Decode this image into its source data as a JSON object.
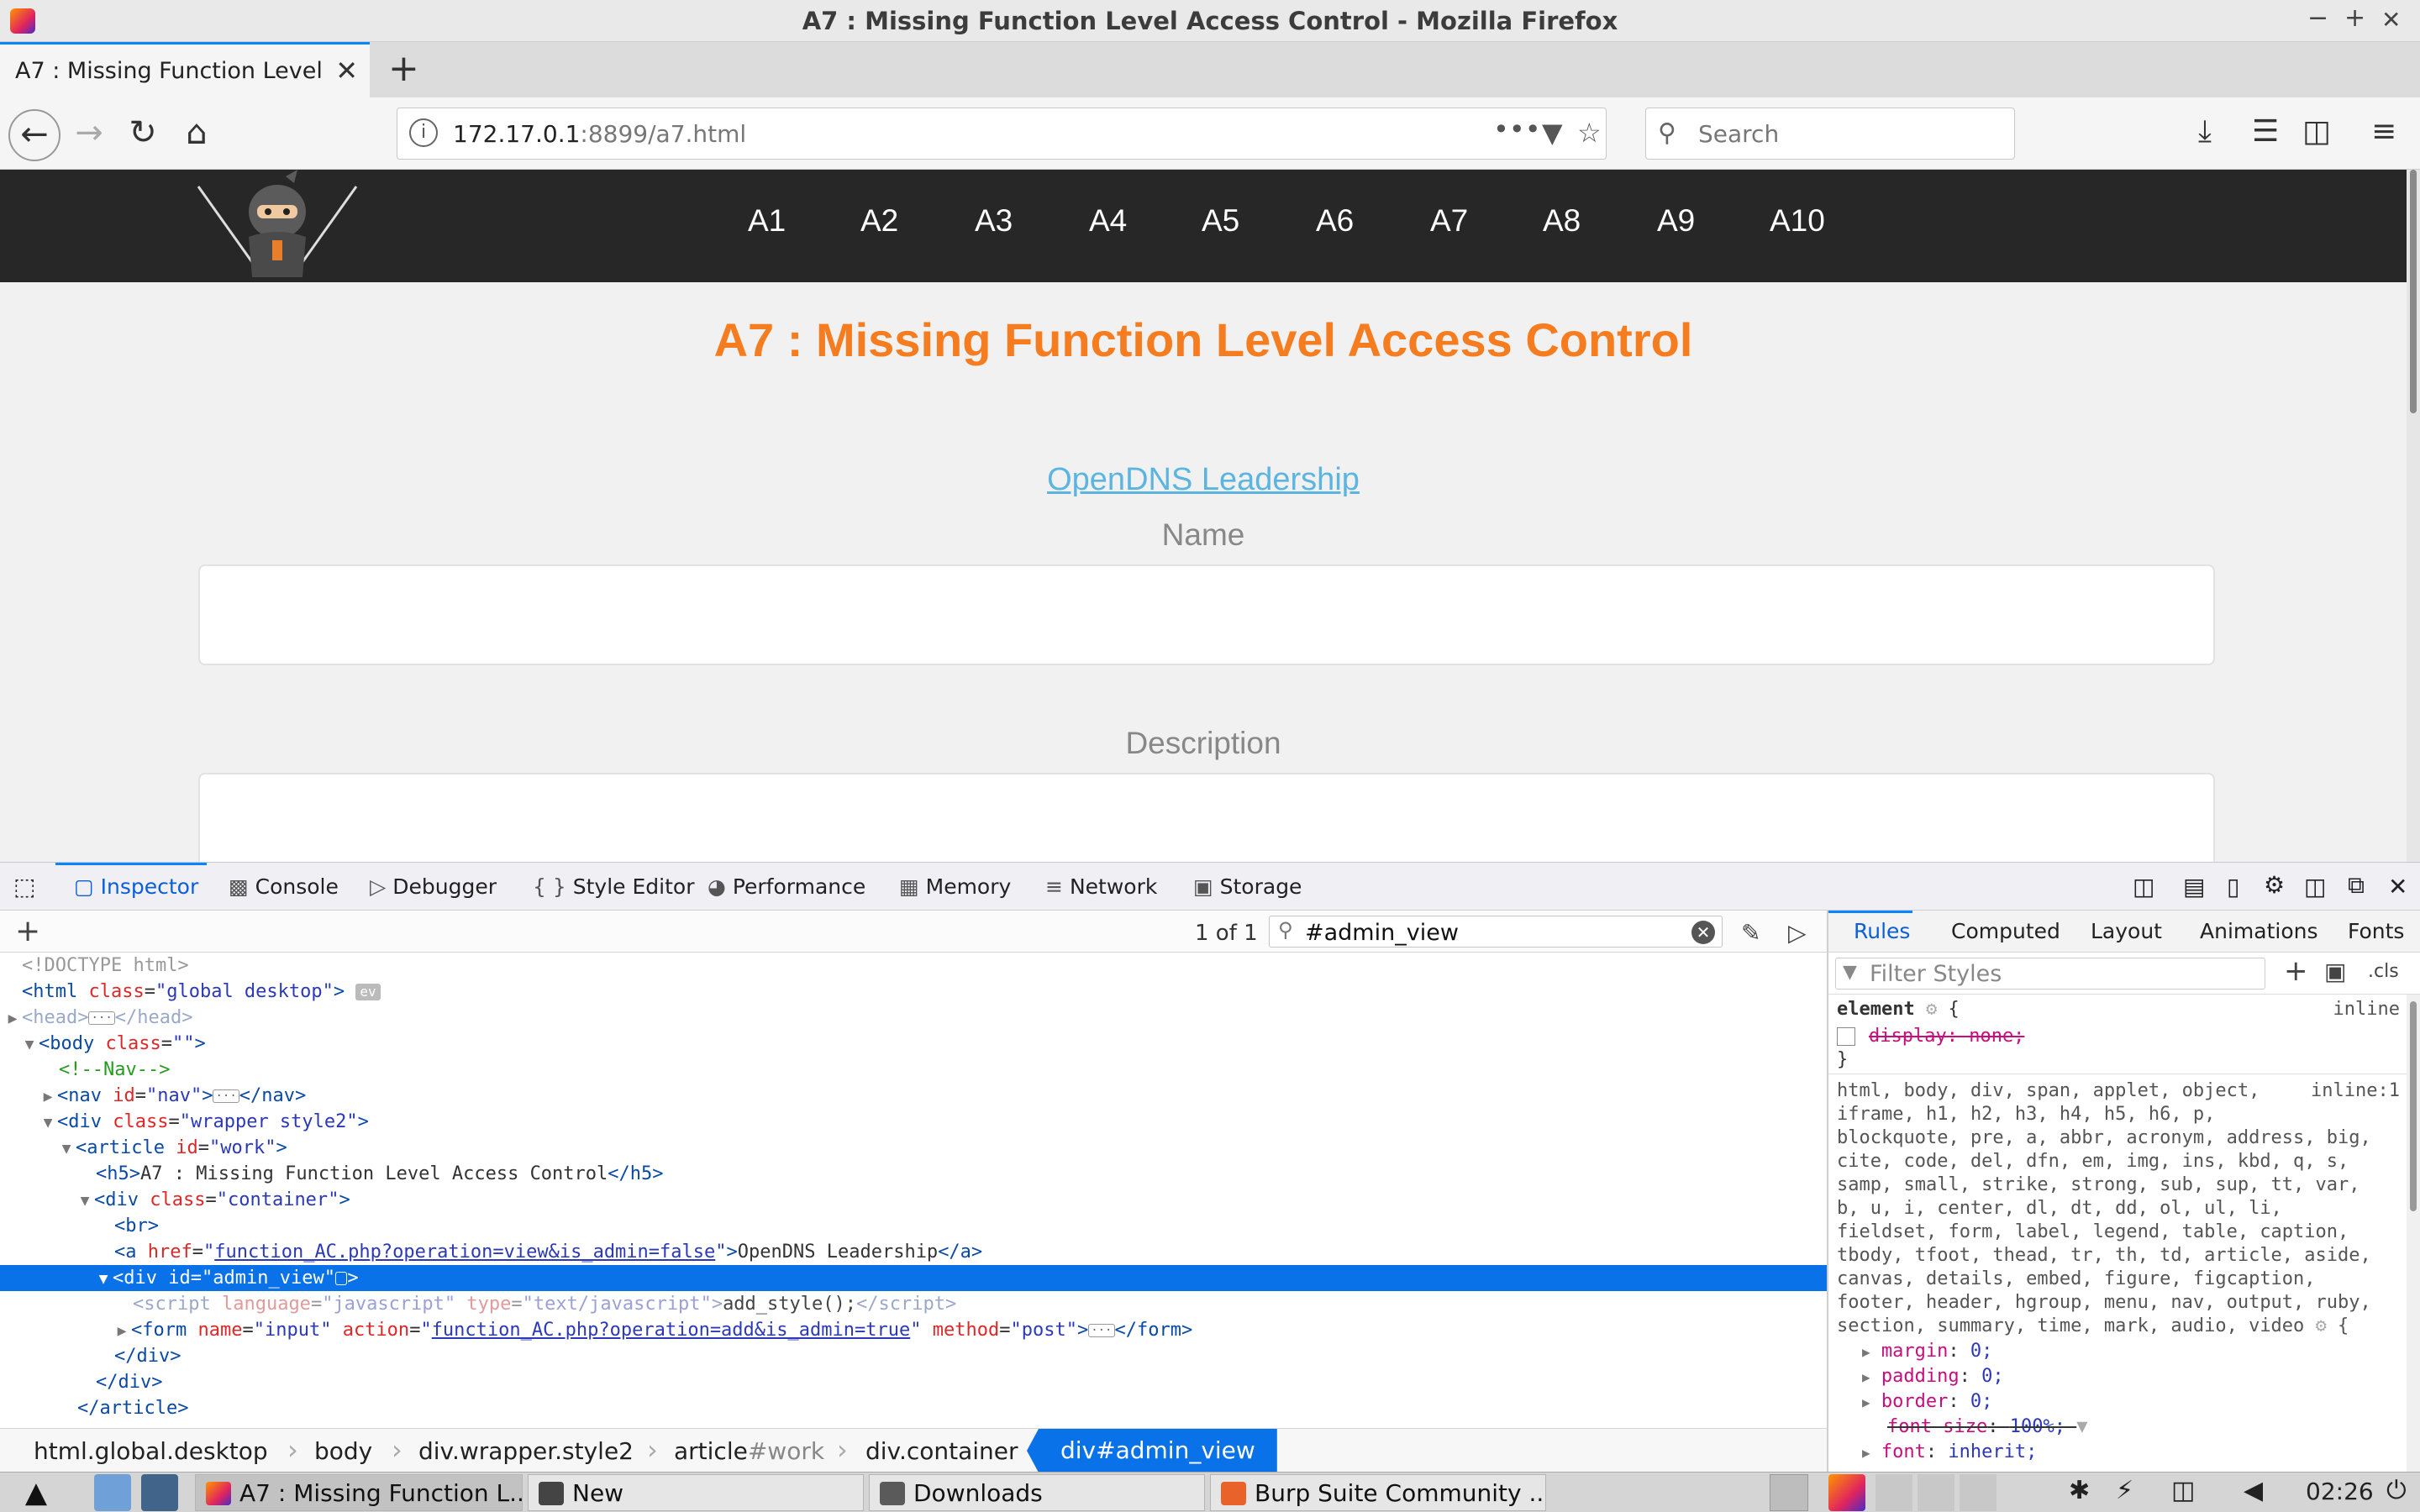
{
  "window": {
    "title": "A7 : Missing Function Level Access Control - Mozilla Firefox",
    "controls": [
      "−",
      "+",
      "✕"
    ]
  },
  "tab": {
    "title": "A7 : Missing Function Level A",
    "close": "✕",
    "new_tab": "+"
  },
  "nav": {
    "url_host": "172.17.0.1",
    "url_rest": ":8899/a7.html",
    "search_placeholder": "Search",
    "page_actions": "•••"
  },
  "site": {
    "menu": [
      "A1",
      "A2",
      "A3",
      "A4",
      "A5",
      "A6",
      "A7",
      "A8",
      "A9",
      "A10"
    ],
    "heading": "A7 : Missing Function Level Access Control",
    "link": "OpenDNS Leadership",
    "name_label": "Name",
    "description_label": "Description"
  },
  "devtools": {
    "tabs": {
      "inspector": "Inspector",
      "console": "Console",
      "debugger": "Debugger",
      "style_editor": "Style Editor",
      "performance": "Performance",
      "memory": "Memory",
      "network": "Network",
      "storage": "Storage"
    },
    "search_count": "1 of 1",
    "search_value": "#admin_view",
    "markup": {
      "doctype": "<!DOCTYPE html>",
      "html_class": "global desktop",
      "ev": "ev",
      "nav_comment": "<!--Nav-->",
      "nav_id": "nav",
      "wrapper_class": "wrapper style2",
      "article_id": "work",
      "h5_text": "A7 : Missing Function Level Access Control",
      "container_class": "container",
      "a_href": "function_AC.php?operation=view&is_admin=false",
      "a_text": "OpenDNS Leadership",
      "admin_view_id": "admin_view",
      "script_language": "javascript",
      "script_type": "text/javascript",
      "script_text": "add_style();",
      "form_name": "input",
      "form_action": "function_AC.php?operation=add&is_admin=true",
      "form_method": "post"
    },
    "breadcrumbs": {
      "c1": "html.global.desktop",
      "c2": "body",
      "c3": "div.wrapper.style2",
      "c4_tag": "article",
      "c4_id": "#work",
      "c5": "div.container",
      "selected": "div#admin_view"
    },
    "rules_tabs": {
      "rules": "Rules",
      "computed": "Computed",
      "layout": "Layout",
      "animations": "Animations",
      "fonts": "Fonts"
    },
    "filter_placeholder": "Filter Styles",
    "cls": ".cls",
    "rules": {
      "element_selector": "element",
      "inline": "inline",
      "inline_decl": "display: none;",
      "selector_lines": [
        "html, body, div, span, applet, object,",
        "iframe, h1, h2, h3, h4, h5, h6, p,",
        "blockquote, pre, a, abbr, acronym, address, big,",
        "cite, code, del, dfn, em, img, ins, kbd, q, s,",
        "samp, small, strike, strong, sub, sup, tt, var,",
        "b, u, i, center, dl, dt, dd, ol, ul, li,",
        "fieldset, form, label, legend, table, caption,",
        "tbody, tfoot, thead, tr, th, td, article, aside,",
        "canvas, details, embed, figure, figcaption,",
        "footer, header, hgroup, menu, nav, output, ruby,",
        "section, summary, time, mark, audio, video"
      ],
      "source": "inline:1",
      "decls": [
        {
          "p": "margin",
          "v": "0;"
        },
        {
          "p": "padding",
          "v": "0;"
        },
        {
          "p": "border",
          "v": "0;"
        },
        {
          "p": "font-size",
          "v": "100%;"
        },
        {
          "p": "font",
          "v": "inherit;"
        }
      ]
    }
  },
  "taskbar": {
    "firefox_task": "A7 : Missing Function L...",
    "new_task": "New",
    "downloads_task": "Downloads",
    "burp_task": "Burp Suite Community ...",
    "clock": "02:26"
  }
}
